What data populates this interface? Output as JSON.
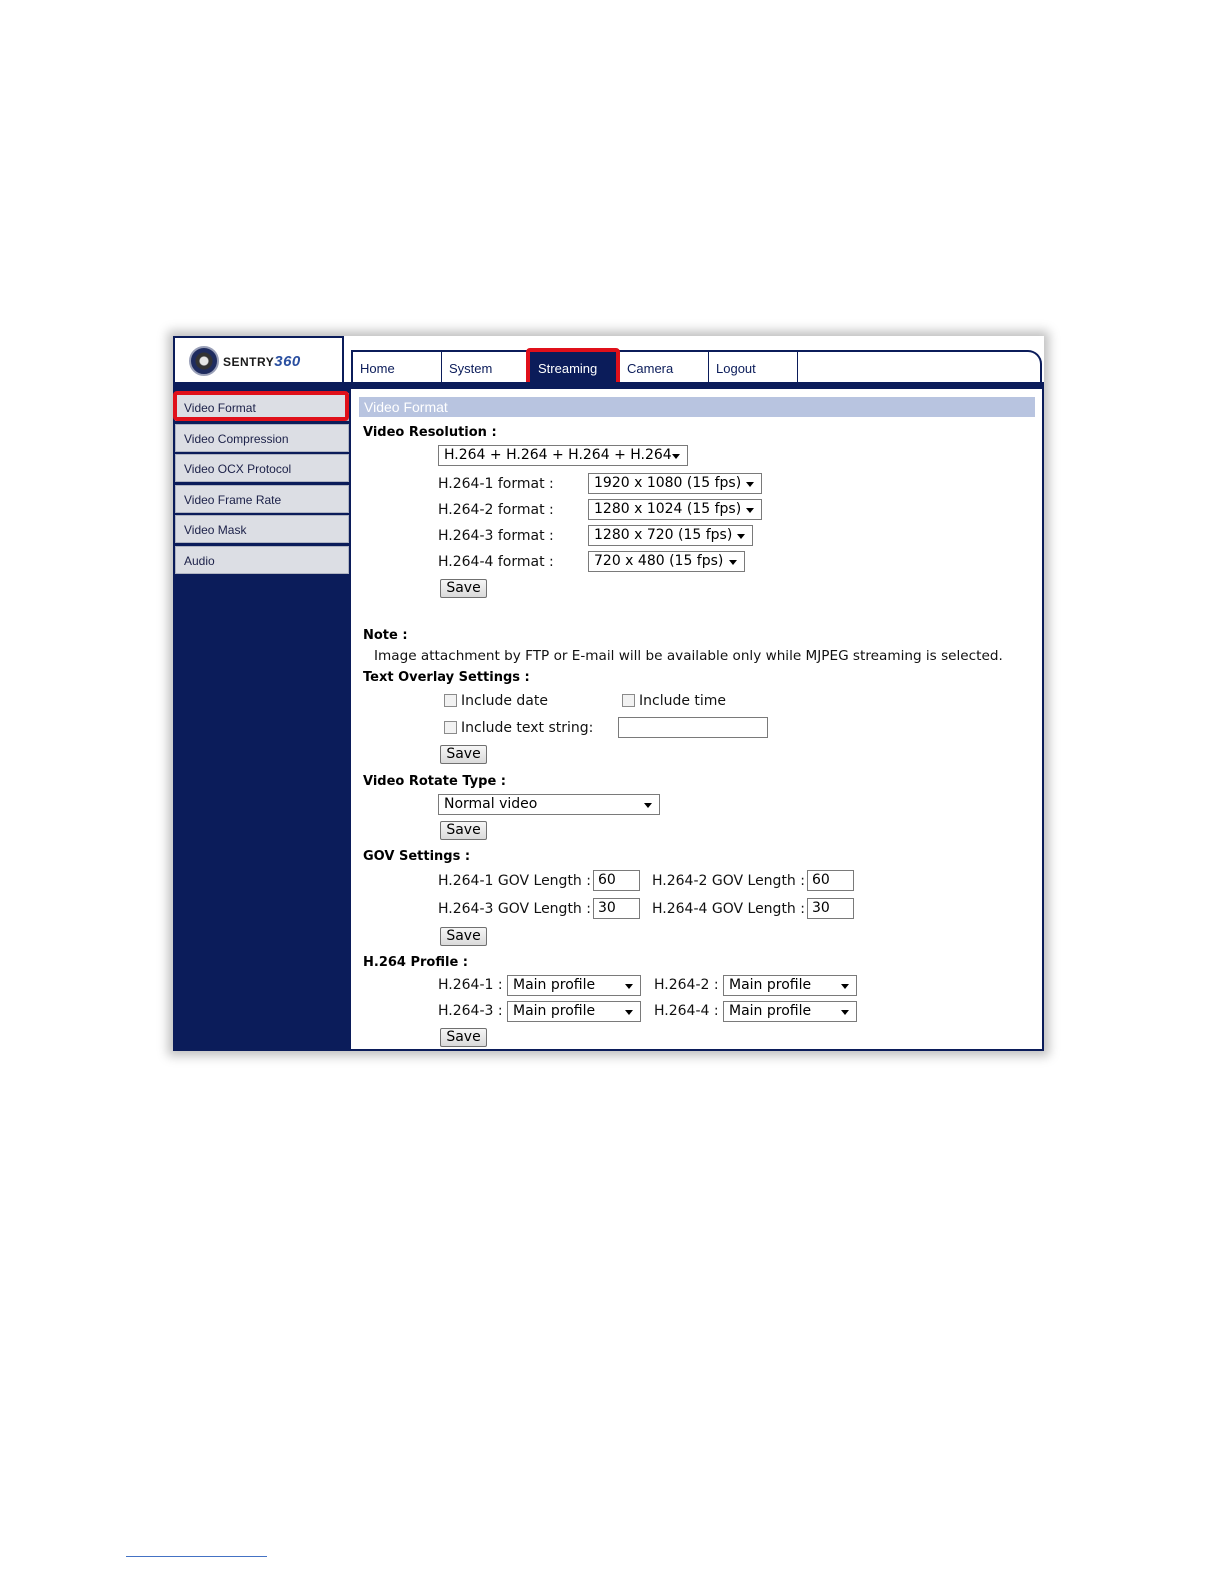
{
  "brand": {
    "name": "SENTRY",
    "number": "360"
  },
  "nav": [
    "Home",
    "System",
    "Streaming",
    "Camera",
    "Logout"
  ],
  "sidebar": [
    "Video Format",
    "Video Compression",
    "Video OCX Protocol",
    "Video Frame Rate",
    "Video Mask",
    "Audio"
  ],
  "title": "Video Format",
  "video_resolution": {
    "heading": "Video Resolution :",
    "mode": "H.264 + H.264 + H.264 + H.264",
    "formats": [
      {
        "label": "H.264-1 format :",
        "value": "1920 x 1080 (15 fps)"
      },
      {
        "label": "H.264-2 format :",
        "value": "1280 x 1024 (15 fps)"
      },
      {
        "label": "H.264-3 format :",
        "value": "1280 x 720 (15 fps)"
      },
      {
        "label": "H.264-4 format :",
        "value": "720 x 480 (15 fps)"
      }
    ]
  },
  "save_label": "Save",
  "note": {
    "heading": "Note :",
    "text": "Image attachment by FTP or E-mail will be available only while MJPEG streaming is selected."
  },
  "overlay": {
    "heading": "Text Overlay Settings :",
    "include_date": "Include date",
    "include_time": "Include time",
    "include_text": "Include text string:",
    "text_value": ""
  },
  "rotate": {
    "heading": "Video Rotate Type :",
    "value": "Normal video"
  },
  "gov": {
    "heading": "GOV Settings :",
    "items": [
      {
        "label": "H.264-1 GOV Length :",
        "value": "60"
      },
      {
        "label": "H.264-2 GOV Length :",
        "value": "60"
      },
      {
        "label": "H.264-3 GOV Length :",
        "value": "30"
      },
      {
        "label": "H.264-4 GOV Length :",
        "value": "30"
      }
    ]
  },
  "profile": {
    "heading": "H.264 Profile :",
    "items": [
      {
        "label": "H.264-1 :",
        "value": "Main profile"
      },
      {
        "label": "H.264-2 :",
        "value": "Main profile"
      },
      {
        "label": "H.264-3 :",
        "value": "Main profile"
      },
      {
        "label": "H.264-4 :",
        "value": "Main profile"
      }
    ]
  },
  "colors": {
    "navy": "#0b1c5a",
    "highlight": "#e0101a",
    "title_bar": "#b8c4e0"
  }
}
